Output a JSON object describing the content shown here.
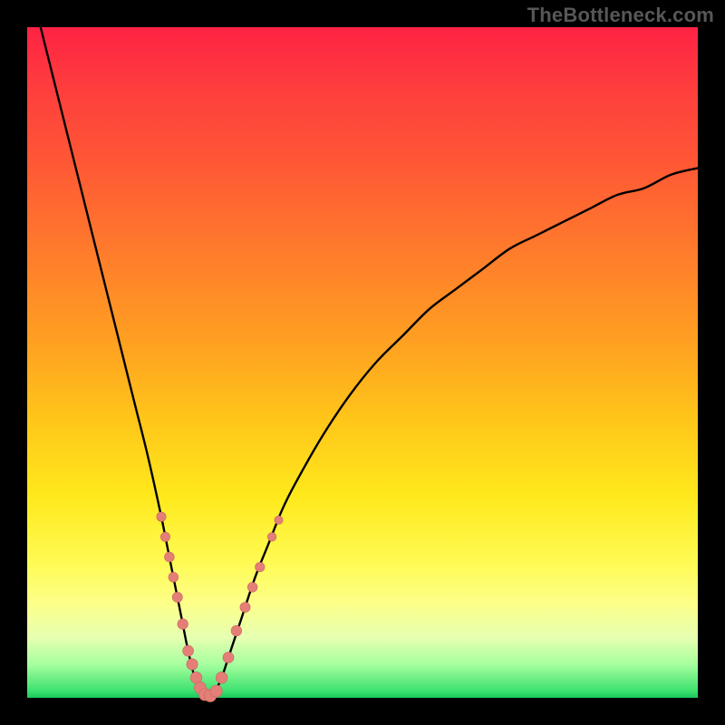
{
  "watermark": "TheBottleneck.com",
  "colors": {
    "background": "#000000",
    "curve": "#000000",
    "marker_fill": "#e47f78",
    "marker_stroke": "#c8645f",
    "gradient_stops": [
      "#fe2244",
      "#ff7a2c",
      "#ffe91c",
      "#fdff8a",
      "#3be16e",
      "#19c75d"
    ]
  },
  "chart_data": {
    "type": "line",
    "title": "",
    "xlabel": "",
    "ylabel": "",
    "xlim": [
      0,
      100
    ],
    "ylim": [
      0,
      100
    ],
    "grid": false,
    "legend": false,
    "series": [
      {
        "name": "curve",
        "x": [
          2,
          4,
          6,
          8,
          10,
          12,
          14,
          16,
          18,
          20,
          21,
          22,
          23,
          24,
          25,
          26,
          27,
          28,
          29,
          30,
          32,
          34,
          36,
          38,
          40,
          44,
          48,
          52,
          56,
          60,
          64,
          68,
          72,
          76,
          80,
          84,
          88,
          92,
          96,
          100
        ],
        "y": [
          100,
          92,
          84,
          76,
          68,
          60,
          52,
          44,
          36,
          27,
          22,
          17,
          12,
          7,
          3,
          1,
          0,
          1,
          3,
          6,
          12,
          18,
          23,
          28,
          32,
          39,
          45,
          50,
          54,
          58,
          61,
          64,
          67,
          69,
          71,
          73,
          75,
          76,
          78,
          79
        ]
      }
    ],
    "markers": [
      {
        "x": 20.0,
        "y": 27.0,
        "size": 5.2
      },
      {
        "x": 20.6,
        "y": 24.0,
        "size": 5.2
      },
      {
        "x": 21.2,
        "y": 21.0,
        "size": 5.4
      },
      {
        "x": 21.8,
        "y": 18.0,
        "size": 5.4
      },
      {
        "x": 22.4,
        "y": 15.0,
        "size": 5.6
      },
      {
        "x": 23.2,
        "y": 11.0,
        "size": 5.8
      },
      {
        "x": 24.0,
        "y": 7.0,
        "size": 6.0
      },
      {
        "x": 24.6,
        "y": 5.0,
        "size": 6.2
      },
      {
        "x": 25.2,
        "y": 3.0,
        "size": 6.4
      },
      {
        "x": 25.8,
        "y": 1.5,
        "size": 6.6
      },
      {
        "x": 26.5,
        "y": 0.5,
        "size": 6.8
      },
      {
        "x": 27.3,
        "y": 0.3,
        "size": 6.8
      },
      {
        "x": 28.2,
        "y": 1.0,
        "size": 6.6
      },
      {
        "x": 29.0,
        "y": 3.0,
        "size": 6.4
      },
      {
        "x": 30.0,
        "y": 6.0,
        "size": 6.0
      },
      {
        "x": 31.2,
        "y": 10.0,
        "size": 5.8
      },
      {
        "x": 32.5,
        "y": 13.5,
        "size": 5.6
      },
      {
        "x": 33.6,
        "y": 16.5,
        "size": 5.4
      },
      {
        "x": 34.7,
        "y": 19.5,
        "size": 5.2
      },
      {
        "x": 36.5,
        "y": 24.0,
        "size": 4.8
      },
      {
        "x": 37.5,
        "y": 26.5,
        "size": 4.6
      }
    ]
  }
}
